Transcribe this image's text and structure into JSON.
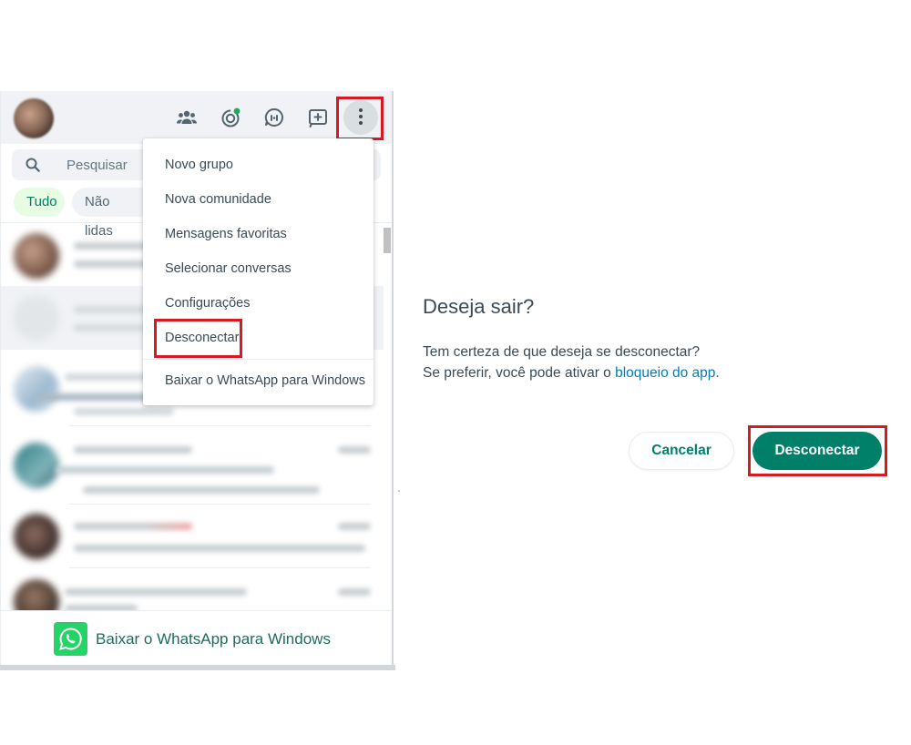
{
  "sidebar": {
    "search_placeholder": "Pesquisar",
    "filters": [
      "Tudo",
      "Não lidas"
    ],
    "download_label": "Baixar o WhatsApp para Windows"
  },
  "header_icons": [
    "communities-icon",
    "status-icon",
    "channels-icon",
    "new-chat-icon",
    "menu-icon"
  ],
  "menu": {
    "items": [
      "Novo grupo",
      "Nova comunidade",
      "Mensagens favoritas",
      "Selecionar conversas",
      "Configurações",
      "Desconectar"
    ],
    "footer_item": "Baixar o WhatsApp para Windows"
  },
  "dialog": {
    "title": "Deseja sair?",
    "line1": "Tem certeza de que deseja se desconectar?",
    "line2_prefix": "Se preferir, você pode ativar o ",
    "line2_link": "bloqueio do app",
    "line2_suffix": ".",
    "cancel_label": "Cancelar",
    "confirm_label": "Desconectar"
  },
  "colors": {
    "accent": "#008069",
    "highlight": "#d71921",
    "link": "#027eb5",
    "whatsapp_green": "#25d366"
  }
}
